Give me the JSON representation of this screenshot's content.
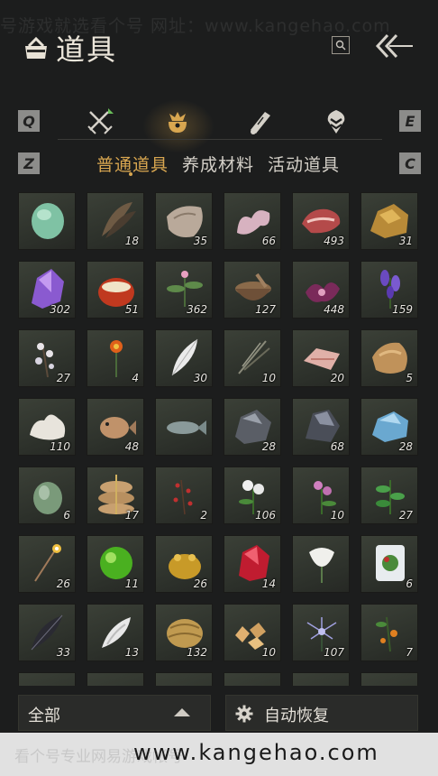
{
  "watermark": {
    "top": "号游戏就选看个号 网址：www.kangehao.com",
    "bottom_text": "看个号专业网易游戏帐号",
    "bottom_url": "www.kangehao.com"
  },
  "header": {
    "title": "道具",
    "search_icon": "search-icon",
    "back_icon": "double-chevron-left-icon"
  },
  "tabs": {
    "left_key": "Q",
    "right_key": "E",
    "categories": [
      {
        "name": "combat",
        "icon": "crossed-swords-icon",
        "active": false
      },
      {
        "name": "items",
        "icon": "pouch-icon",
        "active": true
      },
      {
        "name": "scrolls",
        "icon": "scroll-icon",
        "active": false
      },
      {
        "name": "location",
        "icon": "map-marker-icon",
        "active": false
      }
    ],
    "accent": "#d8a650"
  },
  "subtabs": {
    "left_key": "Z",
    "right_key": "C",
    "items": [
      "普通道具",
      "养成材料",
      "活动道具"
    ],
    "active_index": 0
  },
  "items": [
    {
      "icon": "jade-stone",
      "count": ""
    },
    {
      "icon": "feathers",
      "count": "18"
    },
    {
      "icon": "hide-pelt",
      "count": "35"
    },
    {
      "icon": "pig-intestine",
      "count": "66"
    },
    {
      "icon": "raw-meat",
      "count": "493"
    },
    {
      "icon": "gold-ore",
      "count": "31"
    },
    {
      "icon": "amethyst",
      "count": "302"
    },
    {
      "icon": "chestnut",
      "count": "51"
    },
    {
      "icon": "herb-plant",
      "count": "362"
    },
    {
      "icon": "mortar-bowl",
      "count": "127"
    },
    {
      "icon": "purple-orchid",
      "count": "448"
    },
    {
      "icon": "lavender-flower",
      "count": "159"
    },
    {
      "icon": "white-blossom-branch",
      "count": "27"
    },
    {
      "icon": "orange-flower",
      "count": "4"
    },
    {
      "icon": "white-feather",
      "count": "30"
    },
    {
      "icon": "dry-grass",
      "count": "10"
    },
    {
      "icon": "meat-slice",
      "count": "20"
    },
    {
      "icon": "fur-pelt",
      "count": "5"
    },
    {
      "icon": "coral",
      "count": "110"
    },
    {
      "icon": "pufferfish",
      "count": "48"
    },
    {
      "icon": "fish",
      "count": ""
    },
    {
      "icon": "iron-ore",
      "count": "28"
    },
    {
      "icon": "dark-ore",
      "count": "68"
    },
    {
      "icon": "blue-crystal",
      "count": "28"
    },
    {
      "icon": "green-gourd",
      "count": "6"
    },
    {
      "icon": "grain-sacks",
      "count": "17"
    },
    {
      "icon": "red-berry-branch",
      "count": "2"
    },
    {
      "icon": "white-chrysanthemum",
      "count": "106"
    },
    {
      "icon": "pink-flower",
      "count": "10"
    },
    {
      "icon": "green-herb",
      "count": "27"
    },
    {
      "icon": "firework-stick",
      "count": "26"
    },
    {
      "icon": "green-orb",
      "count": "11"
    },
    {
      "icon": "golden-toad",
      "count": "26"
    },
    {
      "icon": "red-crystal",
      "count": "14"
    },
    {
      "icon": "white-lily",
      "count": ""
    },
    {
      "icon": "potted-plant-box",
      "count": "6"
    },
    {
      "icon": "black-feather",
      "count": "33"
    },
    {
      "icon": "white-tail",
      "count": "13"
    },
    {
      "icon": "bamboo-bundle",
      "count": "132"
    },
    {
      "icon": "amber-pieces",
      "count": "10"
    },
    {
      "icon": "blue-spider-lily",
      "count": "107"
    },
    {
      "icon": "orange-fruit-branch",
      "count": "7"
    }
  ],
  "footer": {
    "filter_label": "全部",
    "filter_icon": "caret-up-icon",
    "restore_label": "自动恢复",
    "restore_icon": "gear-icon"
  }
}
